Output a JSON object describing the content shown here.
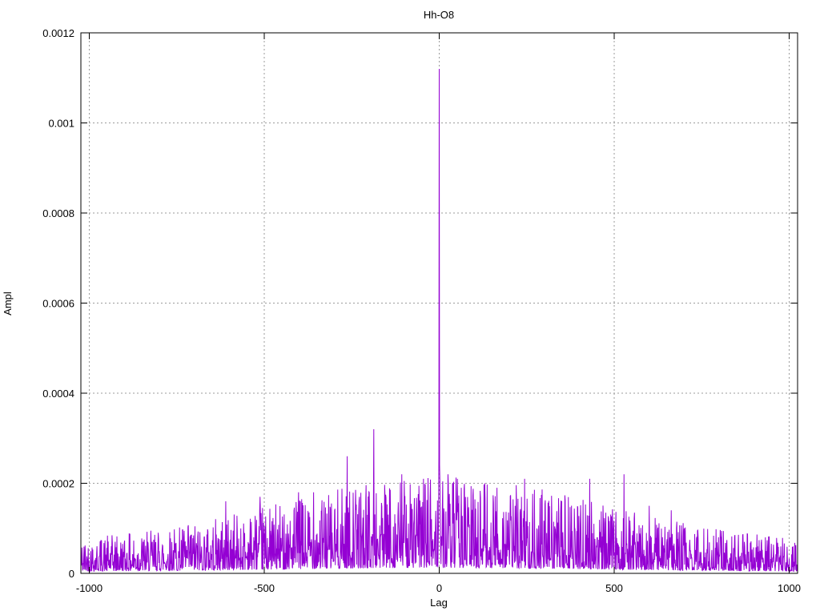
{
  "chart_data": {
    "type": "line",
    "title": "Hh-O8",
    "xlabel": "Lag",
    "ylabel": "Ampl",
    "xlim": [
      -1024,
      1024
    ],
    "ylim": [
      0,
      0.0012
    ],
    "xticks": {
      "values": [
        -1000,
        -500,
        0,
        500,
        1000
      ],
      "labels": [
        "-1000",
        "-500",
        "0",
        "500",
        "1000"
      ]
    },
    "yticks": {
      "values": [
        0,
        0.0002,
        0.0004,
        0.0006,
        0.0008,
        0.001,
        0.0012
      ],
      "labels": [
        "0",
        "0.0002",
        "0.0004",
        "0.0006",
        "0.0008",
        "0.001",
        "0.0012"
      ]
    },
    "grid": {
      "visible": true,
      "color": "#9b9b9b",
      "dash": "2,3"
    },
    "legend": {
      "visible": false
    },
    "colors": {
      "line": "#9400d3",
      "border": "#000000",
      "text": "#000000",
      "background": "#ffffff"
    },
    "main_peak": {
      "lag": 0,
      "value": 0.00112
    },
    "notable_peaks": [
      {
        "lag": -1,
        "value": 0.00026
      },
      {
        "lag": 1,
        "value": 0.00024
      },
      {
        "lag": 2,
        "value": 0.0002
      },
      {
        "lag": -187,
        "value": 0.00032
      },
      {
        "lag": -263,
        "value": 0.00026
      },
      {
        "lag": -107,
        "value": 0.00022
      },
      {
        "lag": -45,
        "value": 0.00021
      },
      {
        "lag": 25,
        "value": 0.00022
      },
      {
        "lag": 63,
        "value": 0.00019
      },
      {
        "lag": 130,
        "value": 0.0002
      },
      {
        "lag": 165,
        "value": 0.00019
      },
      {
        "lag": 244,
        "value": 0.00021
      },
      {
        "lag": 430,
        "value": 0.00021
      },
      {
        "lag": 528,
        "value": 0.00022
      },
      {
        "lag": -359,
        "value": 0.00018
      },
      {
        "lag": -402,
        "value": 0.00018
      },
      {
        "lag": -512,
        "value": 0.00017
      },
      {
        "lag": -610,
        "value": 0.00016
      },
      {
        "lag": 600,
        "value": 0.00015
      },
      {
        "lag": 663,
        "value": 0.00014
      }
    ],
    "noise_model": {
      "seed": 42,
      "lag_min": -1023,
      "lag_max": 1023,
      "envelope_base": 5.5e-05,
      "envelope_bump": 0.00012,
      "envelope_width": 650,
      "power": 2.2,
      "floor": 0.07,
      "gain": 1.15
    }
  }
}
